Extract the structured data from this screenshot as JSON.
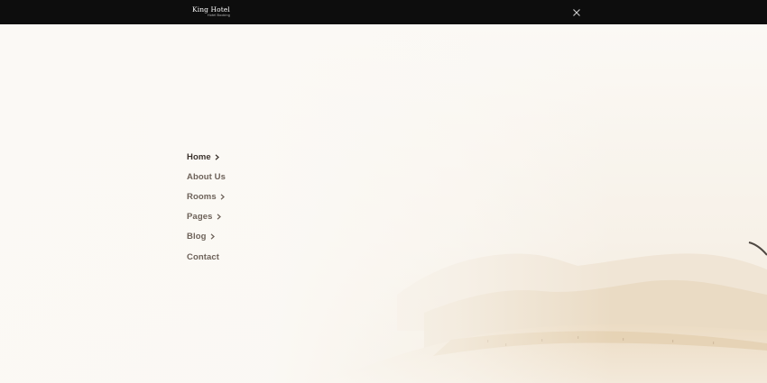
{
  "header": {
    "logo_name": "King Hotel",
    "logo_tagline": "Hotel Booking",
    "close_icon": "close-icon",
    "background_color": "#0d0d0d"
  },
  "menu": {
    "items": [
      {
        "label": "Home",
        "has_submenu": true,
        "active": true
      },
      {
        "label": "About Us",
        "has_submenu": false,
        "active": false
      },
      {
        "label": "Rooms",
        "has_submenu": true,
        "active": false
      },
      {
        "label": "Pages",
        "has_submenu": true,
        "active": false
      },
      {
        "label": "Blog",
        "has_submenu": true,
        "active": false
      },
      {
        "label": "Contact",
        "has_submenu": false,
        "active": false
      }
    ],
    "text_color": "#6d6259",
    "submenu_icon": "chevron-right-icon"
  },
  "hero": {
    "image": "hazy-beach-coastline",
    "overlay_color": "#faf7f1"
  }
}
